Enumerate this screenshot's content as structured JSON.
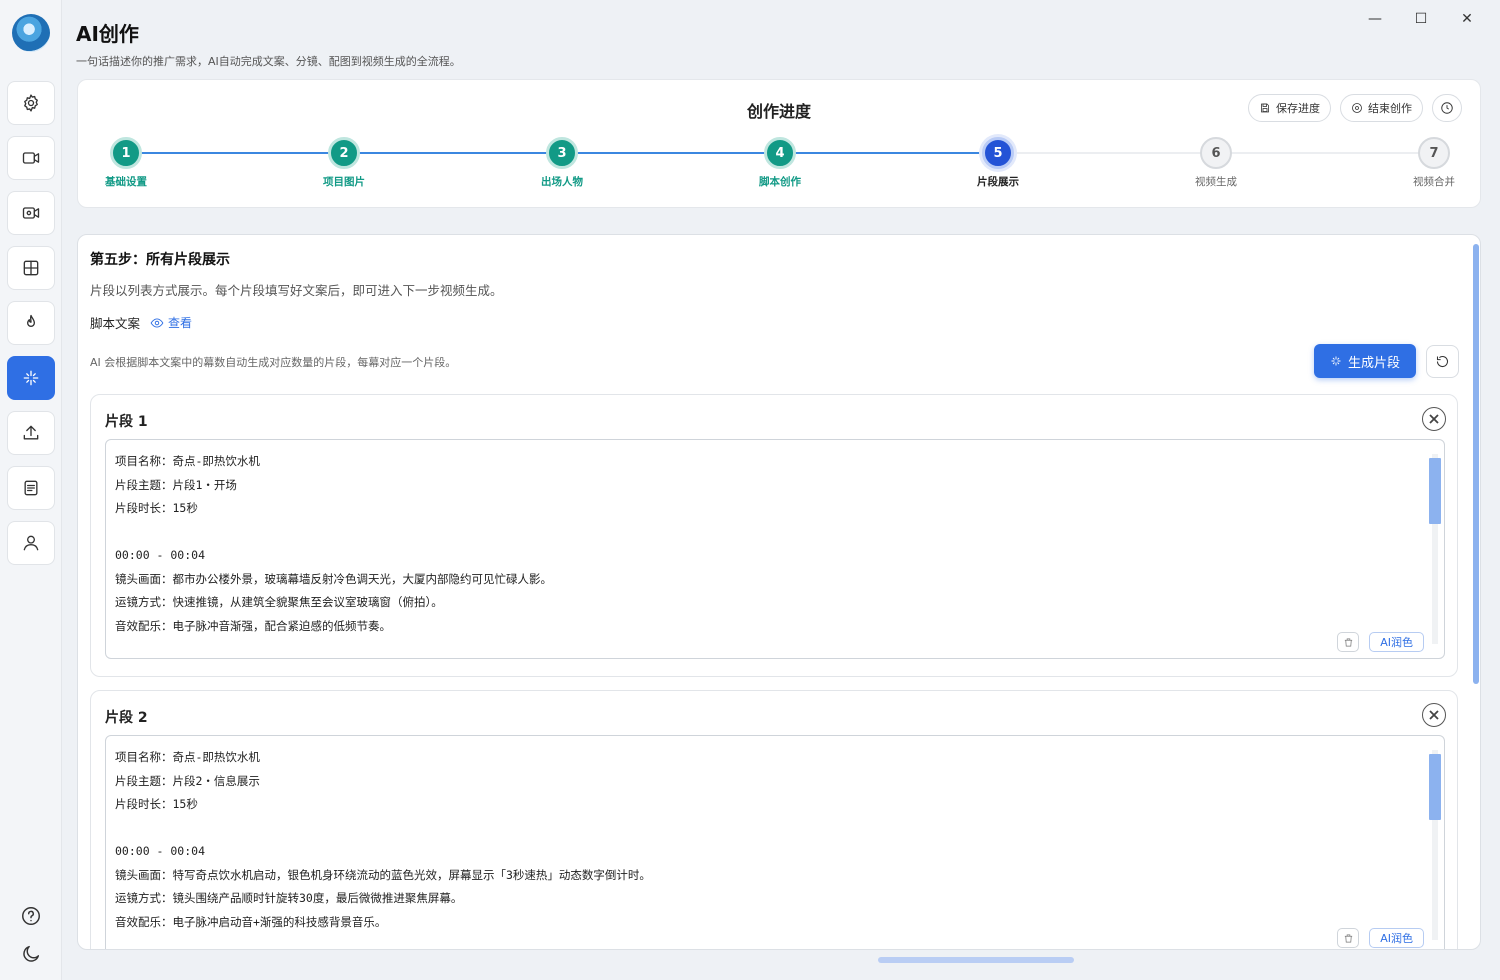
{
  "app": {
    "title": "AI创作",
    "subtitle": "一句话描述你的推广需求，AI自动完成文案、分镜、配图到视频生成的全流程。"
  },
  "window_controls": {
    "minimize": "—",
    "maximize": "☐",
    "close": "✕"
  },
  "sidebar": {
    "items": [
      {
        "icon": "gear-icon"
      },
      {
        "icon": "video-camera-icon"
      },
      {
        "icon": "video-record-icon"
      },
      {
        "icon": "grid-icon"
      },
      {
        "icon": "flame-icon"
      },
      {
        "icon": "sparkle-icon",
        "active": true
      },
      {
        "icon": "upload-icon"
      },
      {
        "icon": "document-icon"
      },
      {
        "icon": "user-icon"
      }
    ],
    "bottom": [
      {
        "icon": "help-icon"
      },
      {
        "icon": "moon-icon"
      }
    ]
  },
  "progress": {
    "title": "创作进度",
    "save_label": "保存进度",
    "end_label": "结束创作",
    "steps": [
      {
        "number": "1",
        "label": "基础设置",
        "status": "done"
      },
      {
        "number": "2",
        "label": "项目图片",
        "status": "done"
      },
      {
        "number": "3",
        "label": "出场人物",
        "status": "done"
      },
      {
        "number": "4",
        "label": "脚本创作",
        "status": "done"
      },
      {
        "number": "5",
        "label": "片段展示",
        "status": "current"
      },
      {
        "number": "6",
        "label": "视频生成",
        "status": "pending"
      },
      {
        "number": "7",
        "label": "视频合并",
        "status": "pending"
      }
    ]
  },
  "main": {
    "heading": "第五步：所有片段展示",
    "description": "片段以列表方式展示。每个片段填写好文案后，即可进入下一步视频生成。",
    "script_label": "脚本文案",
    "view_label": "查看",
    "hint": "AI 会根据脚本文案中的幕数自动生成对应数量的片段，每幕对应一个片段。",
    "generate_label": "生成片段",
    "segments": [
      {
        "title": "片段 1",
        "lines": [
          "项目名称：奇点-即热饮水机",
          "片段主题：片段1・开场",
          "片段时长：15秒",
          "",
          "00:00 - 00:04",
          "镜头画面：都市办公楼外景，玻璃幕墙反射冷色调天光，大厦内部隐约可见忙碌人影。",
          "运镜方式：快速推镜，从建筑全貌聚焦至会议室玻璃窗（俯拍）。",
          "音效配乐：电子脉冲音渐强，配合紧迫感的低频节奏。"
        ],
        "ai_label": "AI润色"
      },
      {
        "title": "片段 2",
        "lines": [
          "项目名称：奇点-即热饮水机",
          "片段主题：片段2・信息展示",
          "片段时长：15秒",
          "",
          "00:00 - 00:04",
          "镜头画面：特写奇点饮水机启动，银色机身环绕流动的蓝色光效，屏幕显示「3秒速热」动态数字倒计时。",
          "运镜方式：镜头围绕产品顺时针旋转30度，最后微微推进聚焦屏幕。",
          "音效配乐：电子脉冲启动音+渐强的科技感背景音乐。"
        ],
        "ai_label": "AI润色"
      }
    ]
  },
  "colors": {
    "accent": "#2f6fe4",
    "done": "#129a86",
    "current": "#2453d6"
  }
}
